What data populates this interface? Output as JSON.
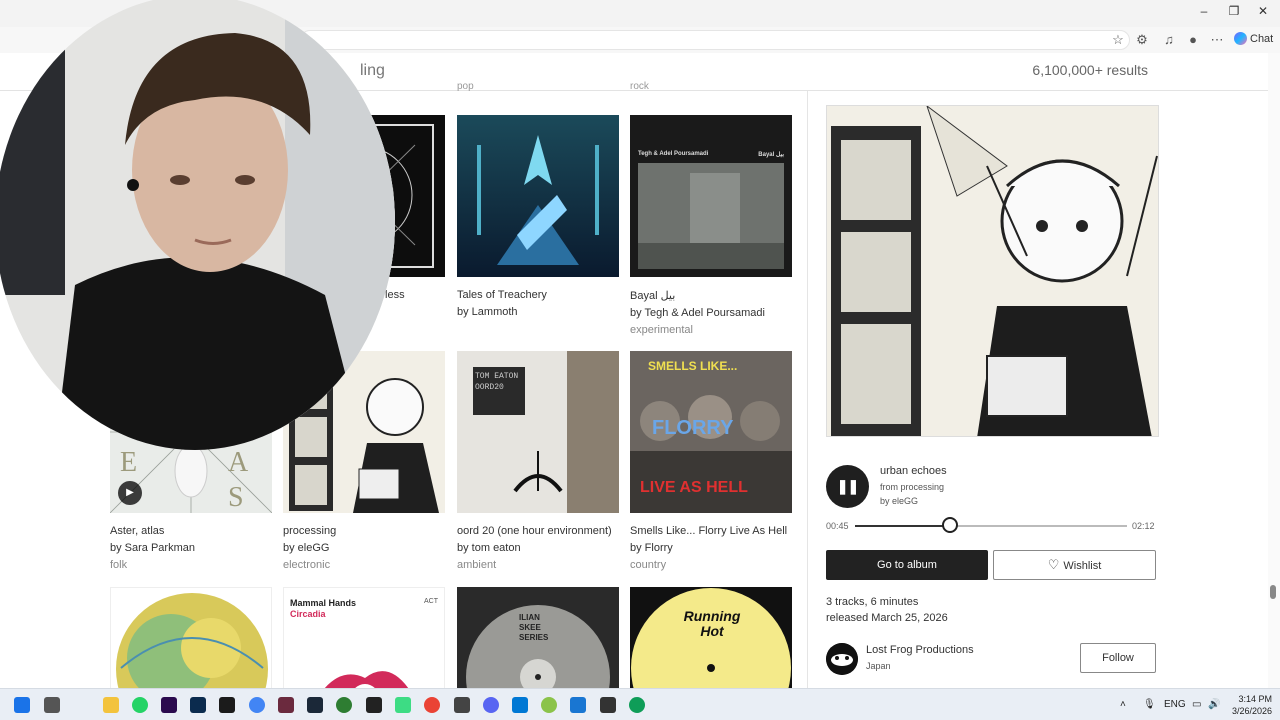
{
  "browser": {
    "chat_label": "Chat"
  },
  "search": {
    "query_partial": "ling",
    "results_count": "6,100,000+ results"
  },
  "grid": {
    "row1": [
      {
        "title": "g Sorrowless",
        "artist": "",
        "genre": ""
      },
      {
        "title": "Tales of Treachery",
        "artist": "by Lammoth",
        "genre": ""
      },
      {
        "title": "Bayal بیل",
        "artist": "by Tegh & Adel Poursamadi",
        "genre": "experimental",
        "cover_text_left": "Tegh & Adel Poursamadi",
        "cover_text_right": "Bayal بیل"
      }
    ],
    "row2": [
      {
        "title": "Aster, atlas",
        "artist": "by Sara Parkman",
        "genre": "folk"
      },
      {
        "title": "processing",
        "artist": "by eleGG",
        "genre": "electronic"
      },
      {
        "title": "oord 20 (one hour environment)",
        "artist": "by tom eaton",
        "genre": "ambient",
        "cover_text": "TOM EATON OORD20"
      },
      {
        "title": "Smells Like... Florry Live As Hell",
        "artist": "by Florry",
        "genre": "country",
        "cover_text_top": "SMELLS LIKE...",
        "cover_text_mid": "FLORRY",
        "cover_text_bottom": "LIVE AS HELL"
      }
    ],
    "row3": [
      {
        "cover_text": ""
      },
      {
        "cover_text_top": "Mammal Hands",
        "cover_text_sub": "Circadia",
        "cover_text_right": "ACT"
      },
      {
        "cover_text": "ILIAN SKEE SERIES"
      },
      {
        "cover_text": "Running Hot"
      }
    ]
  },
  "detail": {
    "track_title": "urban echoes",
    "from": "from processing",
    "by": "by eleGG",
    "time_current": "00:45",
    "time_total": "02:12",
    "progress": 0.35,
    "go_to_album": "Go to album",
    "wishlist": "Wishlist",
    "tracks": "3 tracks, 6 minutes",
    "released": "released March 25, 2026",
    "label_name": "Lost Frog Productions",
    "label_location": "Japan",
    "follow": "Follow"
  },
  "taskbar": {
    "lang": "ENG",
    "time": "3:14 PM",
    "date": "3/26/2026"
  },
  "colors": {
    "accent": "#1f1f1f",
    "taskbar": "#e9eef5"
  }
}
